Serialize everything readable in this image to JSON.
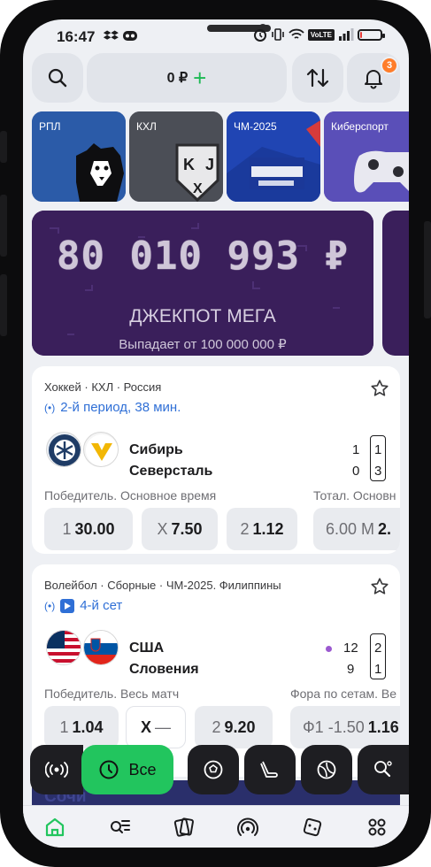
{
  "status_bar": {
    "time": "16:47",
    "network": "VoLTE",
    "battery_percent": 10
  },
  "header": {
    "balance": "0 ₽",
    "notifications_count": "3"
  },
  "sport_tiles": [
    {
      "label": "РПЛ",
      "color": "#2b4a8f"
    },
    {
      "label": "КХЛ",
      "color": "#4a4d55"
    },
    {
      "label": "ЧМ-2025",
      "color": "#1f3fa8"
    },
    {
      "label": "Киберспорт",
      "color": "#5b4bb3"
    }
  ],
  "jackpot": {
    "amount": "80 010 993 ₽",
    "title": "ДЖЕКПОТ МЕГА",
    "subtitle": "Выпадает от 100 000 000 ₽"
  },
  "events": [
    {
      "breadcrumb": "Хоккей · КХЛ · Россия",
      "status": "2-й период, 38 мин.",
      "teams": [
        {
          "name": "Сибирь",
          "score": "1",
          "period": "1"
        },
        {
          "name": "Северсталь",
          "score": "0",
          "period": "3"
        }
      ],
      "market_main": "Победитель. Основное время",
      "market_side": "Тотал. Основн",
      "odds": [
        {
          "key": "1",
          "value": "30.00"
        },
        {
          "key": "X",
          "value": "7.50"
        },
        {
          "key": "2",
          "value": "1.12"
        },
        {
          "key": "6.00 М",
          "value": "2."
        }
      ]
    },
    {
      "breadcrumb": "Волейбол · Сборные · ЧМ-2025. Филиппины",
      "status": "4-й сет",
      "teams": [
        {
          "name": "США",
          "score": "12",
          "period": "2"
        },
        {
          "name": "Словения",
          "score": "9",
          "period": "1"
        }
      ],
      "market_main": "Победитель. Весь матч",
      "market_side": "Фора по сетам. Ве",
      "odds": [
        {
          "key": "1",
          "value": "1.04"
        },
        {
          "key": "X",
          "value": "—"
        },
        {
          "key": "2",
          "value": "9.20"
        },
        {
          "key": "Ф1 -1.50",
          "value": "1.16"
        }
      ]
    }
  ],
  "filter_bar": {
    "all_label": "Все",
    "promo_text": "Сочи"
  },
  "icons": {
    "search": "search-icon",
    "sort": "sort-arrows-icon",
    "bell": "bell-icon",
    "home": "home-icon",
    "catalog": "search-list-icon",
    "coupons": "cards-icon",
    "live": "broadcast-icon",
    "casino": "dice-icon",
    "more": "grid-icon"
  },
  "colors": {
    "accent": "#22c55e",
    "live_blue": "#2f6fd6",
    "jackpot_bg": "#3a1f5b",
    "badge": "#ff7d2a"
  }
}
